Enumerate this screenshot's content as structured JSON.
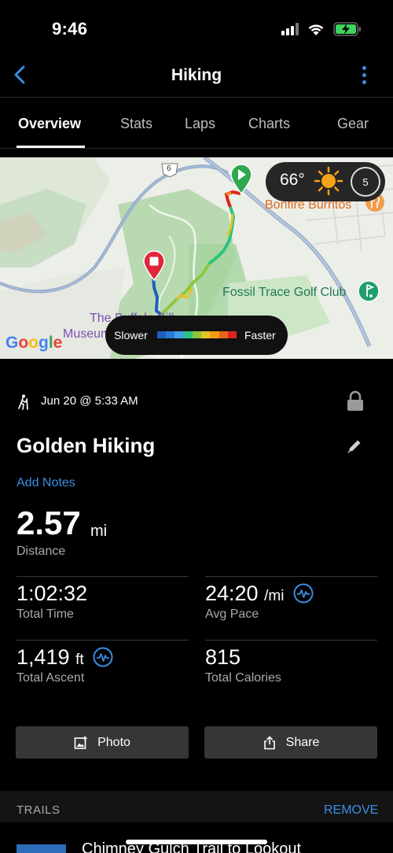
{
  "status_bar": {
    "time": "9:46"
  },
  "nav": {
    "title": "Hiking"
  },
  "tabs": [
    {
      "label": "Overview",
      "active": true
    },
    {
      "label": "Stats"
    },
    {
      "label": "Laps"
    },
    {
      "label": "Charts"
    },
    {
      "label": "Gear"
    }
  ],
  "map": {
    "weather": {
      "temperature": "66°",
      "wind_speed": "5",
      "icon": "sun-icon"
    },
    "labels": {
      "road_number": "6",
      "bonfire": "Bonfire Burritos",
      "golf": "Fossil Trace Golf Club",
      "museum_top": "The Buffalo Bill",
      "museum": "Museum",
      "google": "Google"
    },
    "speed_legend": {
      "slower": "Slower",
      "faster": "Faster",
      "colors": [
        "#1e5fbf",
        "#2a7ad6",
        "#3fa0e6",
        "#2ec27e",
        "#8cc63f",
        "#e6c229",
        "#f39c12",
        "#e8641c",
        "#d9261c"
      ]
    }
  },
  "activity": {
    "date": "Jun 20 @ 5:33 AM",
    "name": "Golden Hiking",
    "add_notes": "Add Notes",
    "distance": {
      "value": "2.57",
      "unit": "mi",
      "label": "Distance"
    },
    "stats": {
      "total_time": {
        "value": "1:02:32",
        "label": "Total Time"
      },
      "avg_pace": {
        "value": "24:20",
        "unit": "/mi",
        "label": "Avg Pace"
      },
      "total_ascent": {
        "value": "1,419",
        "unit": "ft",
        "label": "Total Ascent"
      },
      "total_calories": {
        "value": "815",
        "label": "Total Calories"
      }
    }
  },
  "actions": {
    "photo": "Photo",
    "share": "Share"
  },
  "trails": {
    "title": "TRAILS",
    "remove": "REMOVE",
    "items": [
      {
        "name": "Chimney Gulch Trail to Lookout"
      }
    ]
  },
  "colors": {
    "accent": "#3a8de0",
    "start_marker": "#2fa84f",
    "end_marker": "#e0263a"
  }
}
